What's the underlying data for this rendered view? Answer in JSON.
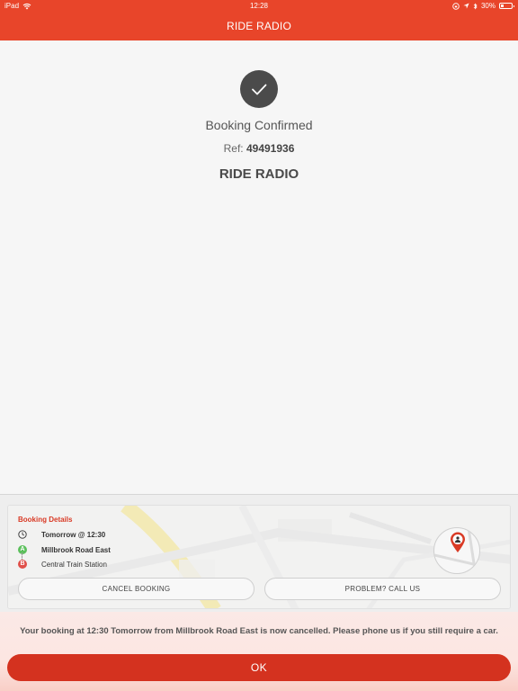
{
  "status_bar": {
    "device": "iPad",
    "time": "12:28",
    "battery": "30%",
    "battery_level": 0.3
  },
  "nav": {
    "title": "RIDE RADIO"
  },
  "confirmation": {
    "title": "Booking Confirmed",
    "ref_label": "Ref:",
    "ref_number": "49491936",
    "brand": "RIDE RADIO"
  },
  "booking": {
    "heading": "Booking Details",
    "when": "Tomorrow @ 12:30",
    "pickup_marker": "A",
    "pickup": "Millbrook Road East",
    "dropoff_marker": "B",
    "dropoff": "Central Train Station"
  },
  "actions": {
    "cancel_label": "CANCEL BOOKING",
    "call_label": "PROBLEM? CALL US"
  },
  "alert": {
    "message": "Your booking at 12:30 Tomorrow from Millbrook Road East is now cancelled. Please phone us if you still require a car.",
    "ok_label": "OK"
  },
  "colors": {
    "brand": "#e8452a",
    "ok_button": "#d4321f",
    "details_heading": "#d93a25",
    "pickup": "#5cc05c",
    "dropoff": "#e0504a"
  }
}
